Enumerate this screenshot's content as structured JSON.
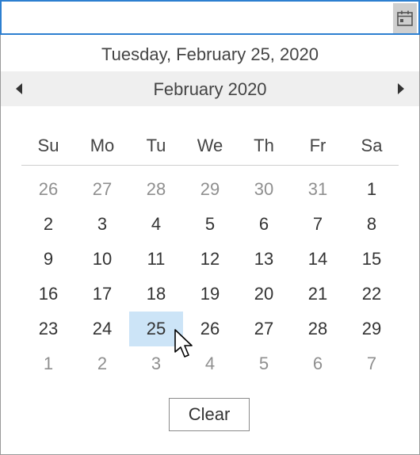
{
  "date_input": {
    "value": "",
    "calendar_icon": "calendar-icon"
  },
  "popup": {
    "full_date": "Tuesday, February 25, 2020",
    "month_title": "February 2020",
    "prev_icon": "chevron-left-icon",
    "next_icon": "chevron-right-icon",
    "weekdays": [
      "Su",
      "Mo",
      "Tu",
      "We",
      "Th",
      "Fr",
      "Sa"
    ],
    "weeks": [
      [
        "26",
        "27",
        "28",
        "29",
        "30",
        "31",
        "1"
      ],
      [
        "2",
        "3",
        "4",
        "5",
        "6",
        "7",
        "8"
      ],
      [
        "9",
        "10",
        "11",
        "12",
        "13",
        "14",
        "15"
      ],
      [
        "16",
        "17",
        "18",
        "19",
        "20",
        "21",
        "22"
      ],
      [
        "23",
        "24",
        "25",
        "26",
        "27",
        "28",
        "29"
      ],
      [
        "1",
        "2",
        "3",
        "4",
        "5",
        "6",
        "7"
      ]
    ],
    "clear_label": "Clear"
  },
  "colors": {
    "focus_border": "#2d7fd0",
    "selected_day_bg": "#cce4f7",
    "nav_bar_bg": "#efefef",
    "other_month_text": "#8f8f8f"
  }
}
